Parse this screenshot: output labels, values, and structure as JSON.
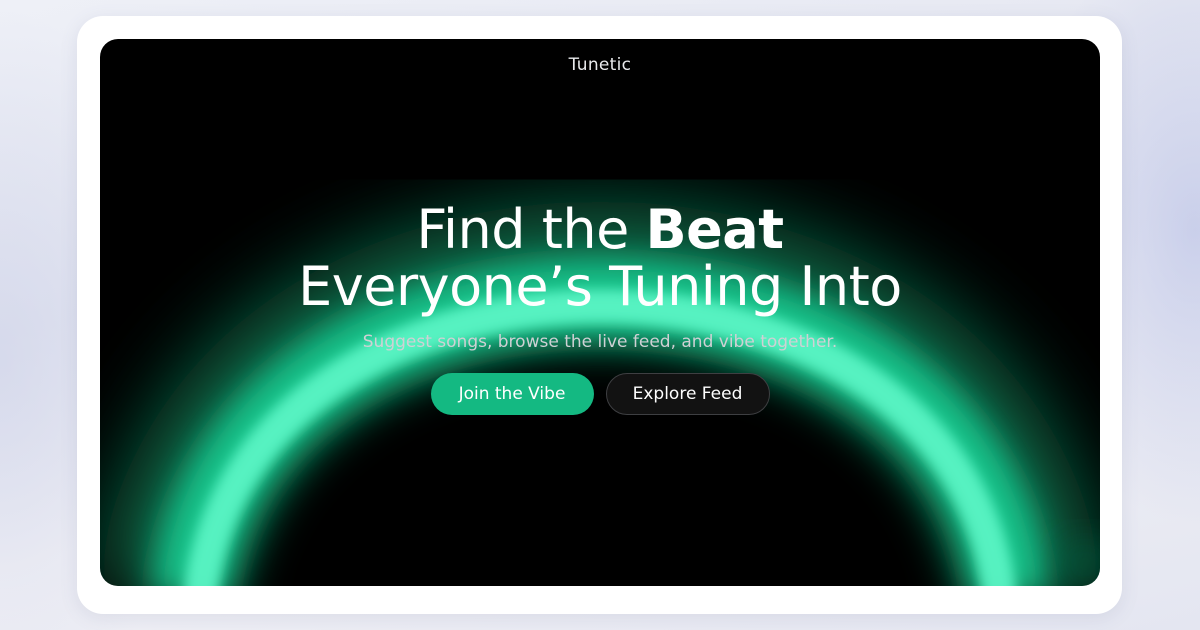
{
  "brand": {
    "name": "Tunetic"
  },
  "hero": {
    "headline_part1": "Find the ",
    "headline_bold": "Beat",
    "headline_line2": "Everyone’s Tuning Into",
    "subtitle": "Suggest songs, browse the live feed, and vibe together."
  },
  "actions": {
    "primary_label": "Join the Vibe",
    "secondary_label": "Explore Feed"
  },
  "colors": {
    "accent": "#14b982",
    "glow": "#2ef0b0",
    "background": "#000000"
  }
}
